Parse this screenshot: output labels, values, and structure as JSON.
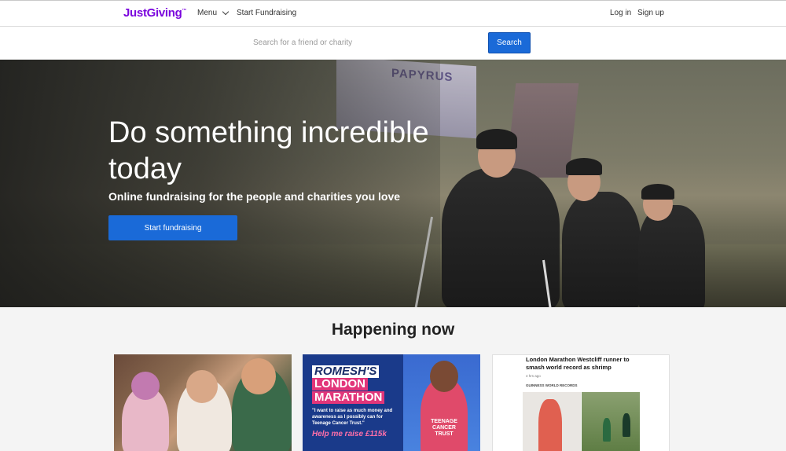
{
  "header": {
    "logo": "JustGiving",
    "logo_mark": "™",
    "menu_label": "Menu",
    "start_fundraising": "Start Fundraising",
    "login": "Log in",
    "signup": "Sign up"
  },
  "search": {
    "placeholder": "Search for a friend or charity",
    "button": "Search"
  },
  "hero": {
    "title": "Do something incredible today",
    "subtitle": "Online fundraising for the people and charities you love",
    "cta": "Start fundraising",
    "flag_text": "PAPYRUS"
  },
  "happening": {
    "title": "Happening now",
    "cards": [
      {
        "kind": "photo"
      },
      {
        "line1": "ROMESH'S",
        "line2": "LONDON",
        "line3": "MARATHON",
        "quote": "\"I want to raise as much money and awareness as I possibly can for Teenage Cancer Trust.\"",
        "help": "Help me raise £115k",
        "shirt": "TEENAGE CANCER TRUST"
      },
      {
        "title": "London Marathon Westcliff runner to smash world record as shrimp",
        "time": "4 hrs ago",
        "source": "GUINNESS WORLD RECORDS"
      }
    ]
  },
  "colors": {
    "brand": "#7a04dd",
    "primary_button": "#1a6ad8"
  },
  "icons": [
    "chevron-down-icon"
  ]
}
